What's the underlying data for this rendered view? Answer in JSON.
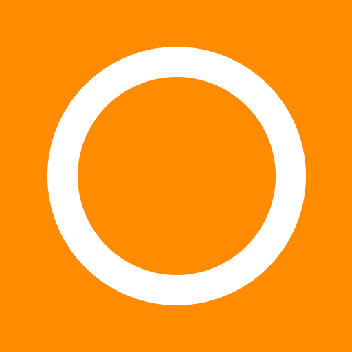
{
  "icon": {
    "name": "ring-icon",
    "background_color": "#ff8c00",
    "ring_color": "#ffffff"
  }
}
